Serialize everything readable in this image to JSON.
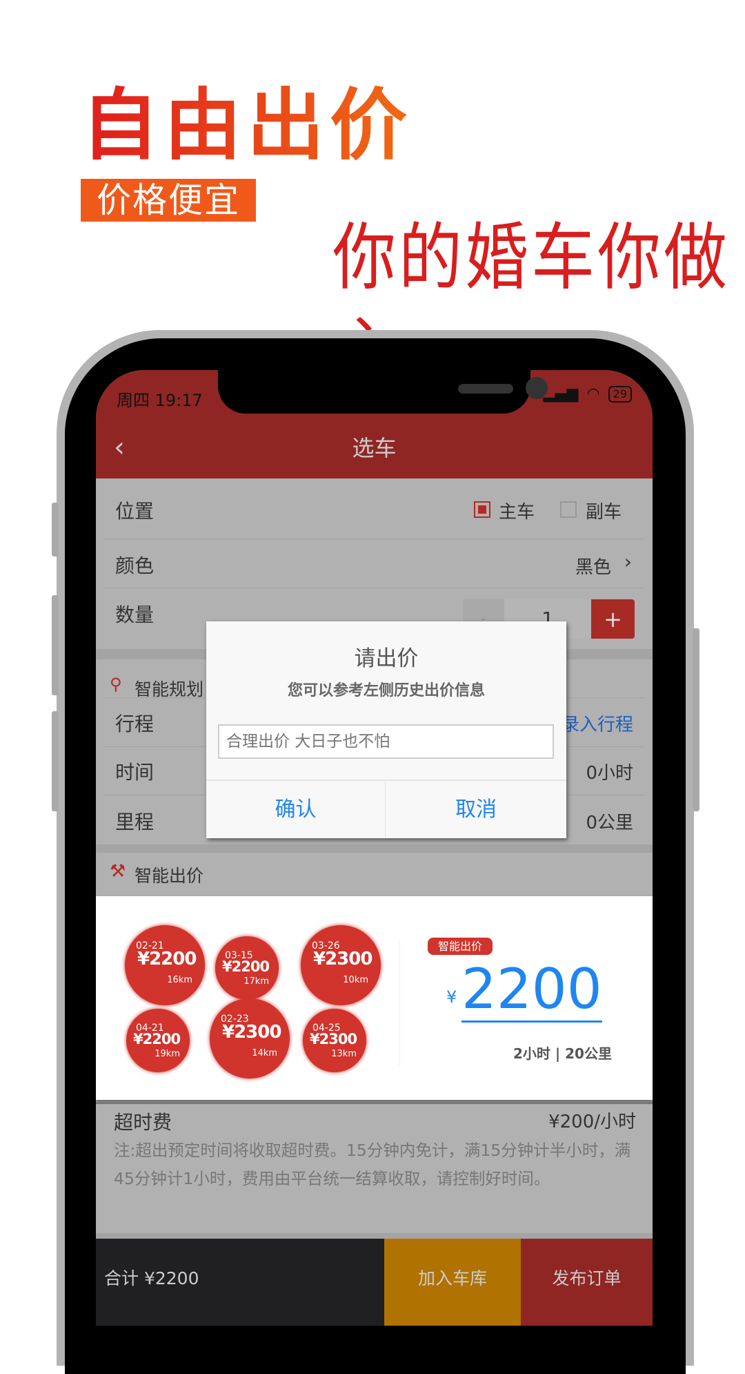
{
  "promo": {
    "headline": "自由出价",
    "tag": "价格便宜",
    "slogan": "你的婚车你做主"
  },
  "status_bar": {
    "time": "周四 19:17",
    "battery": "29",
    "icons": [
      "signal-icon",
      "wifi-icon",
      "battery-icon"
    ]
  },
  "nav": {
    "title": "选车",
    "back_icon": "chevron-left-icon"
  },
  "form": {
    "position": {
      "label": "位置",
      "options": [
        {
          "label": "主车",
          "checked": true
        },
        {
          "label": "副车",
          "checked": false
        }
      ]
    },
    "color": {
      "label": "颜色",
      "value": "黑色"
    },
    "quantity": {
      "label": "数量",
      "minus": "-",
      "value": "1",
      "plus": "+"
    }
  },
  "planning": {
    "section_title": "智能规划",
    "trip": {
      "label": "行程",
      "action": "录入行程"
    },
    "time": {
      "label": "时间",
      "value": "0小时"
    },
    "distance": {
      "label": "里程",
      "value": "0公里"
    }
  },
  "smart_price": {
    "section_title": "智能出价",
    "history": [
      {
        "date": "02-21",
        "price": "¥2200",
        "distance": "16km"
      },
      {
        "date": "03-15",
        "price": "¥2200",
        "distance": "17km"
      },
      {
        "date": "03-26",
        "price": "¥2300",
        "distance": "10km"
      },
      {
        "date": "04-21",
        "price": "¥2200",
        "distance": "19km"
      },
      {
        "date": "02-23",
        "price": "¥2300",
        "distance": "14km"
      },
      {
        "date": "04-25",
        "price": "¥2300",
        "distance": "13km"
      }
    ],
    "badge": "智能出价",
    "currency": "¥",
    "price": "2200",
    "summary": "2小时 | 20公里"
  },
  "overtime": {
    "label": "超时费",
    "rate": "¥200/小时",
    "note": "注:超出预定时间将收取超时费。15分钟内免计，满15分钟计半小时，满45分钟计1小时，费用由平台统一结算收取，请控制好时间。"
  },
  "footer": {
    "total": "合计 ¥2200",
    "add_garage": "加入车库",
    "publish": "发布订单"
  },
  "dialog": {
    "title": "请出价",
    "subtitle": "您可以参考左侧历史出价信息",
    "input_placeholder": "合理出价 大日子也不怕",
    "confirm": "确认",
    "cancel": "取消"
  },
  "colors": {
    "header": "#8f2623",
    "accent_red": "#c0302a",
    "blue": "#1f86f0",
    "amber": "#b07200",
    "promo_orange": "#ef5a1a"
  }
}
